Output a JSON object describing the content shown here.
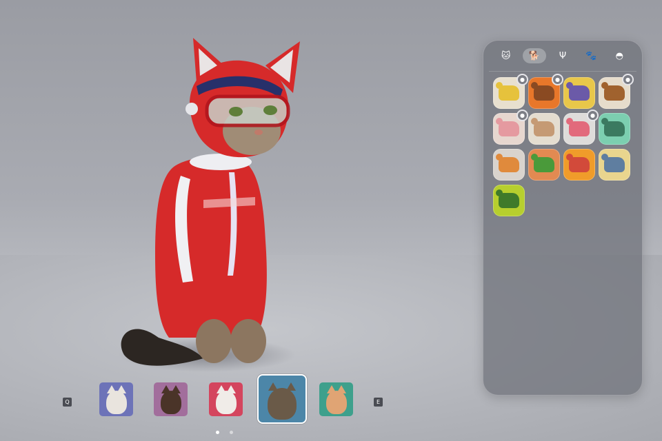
{
  "panel": {
    "tabs": [
      {
        "icon": "cat-head-icon",
        "glyph": "🐱",
        "active": false
      },
      {
        "icon": "dog-sitting-icon",
        "glyph": "🐕",
        "active": true
      },
      {
        "icon": "antler-icon",
        "glyph": "Ψ",
        "active": false
      },
      {
        "icon": "paw-icon",
        "glyph": "🐾",
        "active": false
      },
      {
        "icon": "hat-icon",
        "glyph": "◓",
        "active": false
      }
    ],
    "items": [
      {
        "name": "chick-outfit",
        "bg": "#e8e0cf",
        "pet": "#e6c23c",
        "badge": true
      },
      {
        "name": "bear-outfit",
        "bg": "#e8772a",
        "pet": "#8a4a22",
        "badge": true
      },
      {
        "name": "dino-outfit",
        "bg": "#e8c74a",
        "pet": "#6b5aa8",
        "badge": false
      },
      {
        "name": "puppy-outfit",
        "bg": "#e6dccb",
        "pet": "#a0622e",
        "badge": true
      },
      {
        "name": "pig-outfit",
        "bg": "#e7d7cf",
        "pet": "#e59aa0",
        "badge": true
      },
      {
        "name": "hamster-outfit",
        "bg": "#e4ddd0",
        "pet": "#c59a74",
        "badge": false
      },
      {
        "name": "pink-pig-outfit",
        "bg": "#dedcda",
        "pet": "#e26a7c",
        "badge": true
      },
      {
        "name": "turtle-outfit",
        "bg": "#7ccfb0",
        "pet": "#3b7a60",
        "badge": false
      },
      {
        "name": "fox-outfit",
        "bg": "#d9d3cd",
        "pet": "#e08a3c",
        "badge": false
      },
      {
        "name": "frog-outfit",
        "bg": "#e28a52",
        "pet": "#4a9a3a",
        "badge": false
      },
      {
        "name": "lobster-outfit",
        "bg": "#f09c2a",
        "pet": "#d24a3a",
        "badge": false
      },
      {
        "name": "elephant-outfit",
        "bg": "#e9d58e",
        "pet": "#5f7ea0",
        "badge": false
      },
      {
        "name": "green-frog-outfit",
        "bg": "#b7cf2e",
        "pet": "#3f7a2a",
        "badge": false
      }
    ]
  },
  "carousel": {
    "prev_key": "Q",
    "next_key": "E",
    "cats": [
      {
        "name": "ragdoll-cat",
        "bg": "#6d73b8",
        "fur": "#e9e4de",
        "selected": false
      },
      {
        "name": "tortoiseshell-cat",
        "bg": "#a26e9c",
        "fur": "#4a3428",
        "selected": false
      },
      {
        "name": "white-persian-cat",
        "bg": "#d4455e",
        "fur": "#f0ece8",
        "selected": false
      },
      {
        "name": "tabby-cat",
        "bg": "#4c86a8",
        "fur": "#6a5a48",
        "selected": true
      },
      {
        "name": "orange-cat",
        "bg": "#3ea08c",
        "fur": "#e0a474",
        "selected": false
      }
    ],
    "page_dots": 2,
    "active_page": 0
  },
  "colors": {
    "suit": "#d62a2a",
    "suit_dark": "#a81c1c",
    "helmet_accent": "#27306a",
    "fur": "#8c7660",
    "fur_dark": "#2c2622"
  }
}
